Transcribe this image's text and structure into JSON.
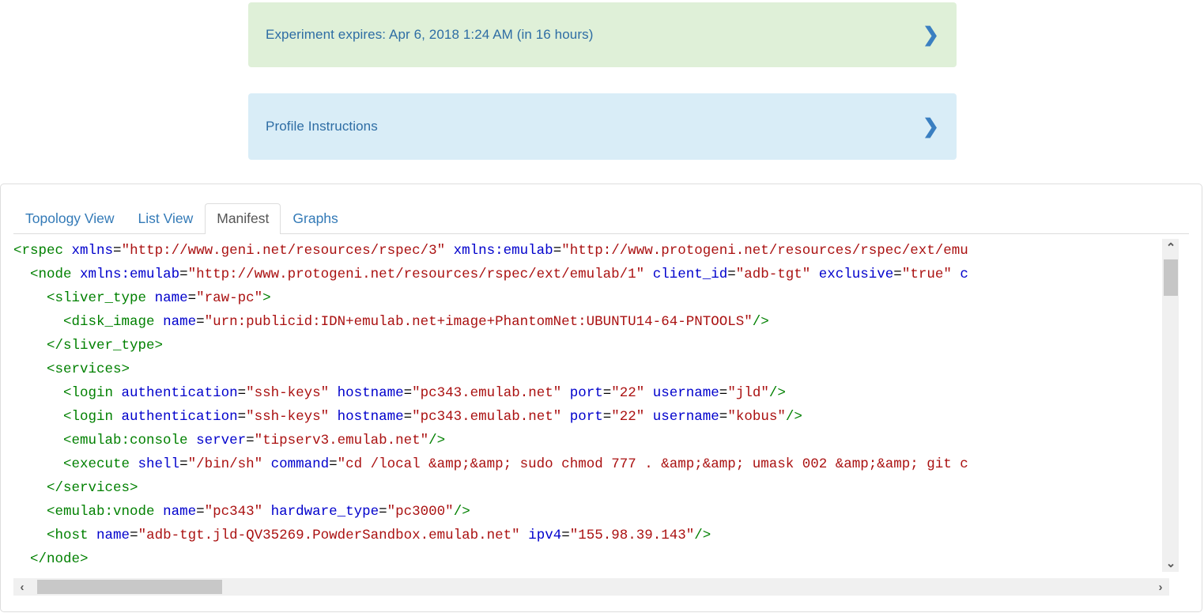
{
  "banners": [
    {
      "id": "expires",
      "label": "Experiment expires: Apr 6, 2018 1:24 AM (in 16 hours)",
      "chevron": "chevron-right-icon",
      "chevron_glyph": "❯",
      "background": "#dff0d8",
      "text_color": "#2e6da4"
    },
    {
      "id": "instructions",
      "label": "Profile Instructions",
      "chevron": "chevron-right-icon",
      "chevron_glyph": "❯",
      "background": "#d9edf7",
      "text_color": "#2e6da4"
    }
  ],
  "tabs": [
    {
      "label": "Topology View",
      "active": false
    },
    {
      "label": "List View",
      "active": false
    },
    {
      "label": "Manifest",
      "active": true
    },
    {
      "label": "Graphs",
      "active": false
    }
  ],
  "manifest": {
    "language": "xml",
    "colors": {
      "tag": "#008000",
      "attribute": "#0000cc",
      "value": "#aa1111",
      "plain": "#000000"
    },
    "lines": [
      {
        "indent": 0,
        "tokens": [
          {
            "t": "tag",
            "s": "<rspec"
          },
          {
            "t": "plain",
            "s": " "
          },
          {
            "t": "attr",
            "s": "xmlns"
          },
          {
            "t": "plain",
            "s": "="
          },
          {
            "t": "val",
            "s": "\"http://www.geni.net/resources/rspec/3\""
          },
          {
            "t": "plain",
            "s": " "
          },
          {
            "t": "attr",
            "s": "xmlns:emulab"
          },
          {
            "t": "plain",
            "s": "="
          },
          {
            "t": "val",
            "s": "\"http://www.protogeni.net/resources/rspec/ext/emu"
          }
        ]
      },
      {
        "indent": 1,
        "tokens": [
          {
            "t": "tag",
            "s": "<node"
          },
          {
            "t": "plain",
            "s": " "
          },
          {
            "t": "attr",
            "s": "xmlns:emulab"
          },
          {
            "t": "plain",
            "s": "="
          },
          {
            "t": "val",
            "s": "\"http://www.protogeni.net/resources/rspec/ext/emulab/1\""
          },
          {
            "t": "plain",
            "s": " "
          },
          {
            "t": "attr",
            "s": "client_id"
          },
          {
            "t": "plain",
            "s": "="
          },
          {
            "t": "val",
            "s": "\"adb-tgt\""
          },
          {
            "t": "plain",
            "s": " "
          },
          {
            "t": "attr",
            "s": "exclusive"
          },
          {
            "t": "plain",
            "s": "="
          },
          {
            "t": "val",
            "s": "\"true\""
          },
          {
            "t": "plain",
            "s": " "
          },
          {
            "t": "attr",
            "s": "c"
          }
        ]
      },
      {
        "indent": 2,
        "tokens": [
          {
            "t": "tag",
            "s": "<sliver_type"
          },
          {
            "t": "plain",
            "s": " "
          },
          {
            "t": "attr",
            "s": "name"
          },
          {
            "t": "plain",
            "s": "="
          },
          {
            "t": "val",
            "s": "\"raw-pc\""
          },
          {
            "t": "tag",
            "s": ">"
          }
        ]
      },
      {
        "indent": 3,
        "tokens": [
          {
            "t": "tag",
            "s": "<disk_image"
          },
          {
            "t": "plain",
            "s": " "
          },
          {
            "t": "attr",
            "s": "name"
          },
          {
            "t": "plain",
            "s": "="
          },
          {
            "t": "val",
            "s": "\"urn:publicid:IDN+emulab.net+image+PhantomNet:UBUNTU14-64-PNTOOLS\""
          },
          {
            "t": "tag",
            "s": "/>"
          }
        ]
      },
      {
        "indent": 2,
        "tokens": [
          {
            "t": "tag",
            "s": "</sliver_type>"
          }
        ]
      },
      {
        "indent": 2,
        "tokens": [
          {
            "t": "tag",
            "s": "<services>"
          }
        ]
      },
      {
        "indent": 3,
        "tokens": [
          {
            "t": "tag",
            "s": "<login"
          },
          {
            "t": "plain",
            "s": " "
          },
          {
            "t": "attr",
            "s": "authentication"
          },
          {
            "t": "plain",
            "s": "="
          },
          {
            "t": "val",
            "s": "\"ssh-keys\""
          },
          {
            "t": "plain",
            "s": " "
          },
          {
            "t": "attr",
            "s": "hostname"
          },
          {
            "t": "plain",
            "s": "="
          },
          {
            "t": "val",
            "s": "\"pc343.emulab.net\""
          },
          {
            "t": "plain",
            "s": " "
          },
          {
            "t": "attr",
            "s": "port"
          },
          {
            "t": "plain",
            "s": "="
          },
          {
            "t": "val",
            "s": "\"22\""
          },
          {
            "t": "plain",
            "s": " "
          },
          {
            "t": "attr",
            "s": "username"
          },
          {
            "t": "plain",
            "s": "="
          },
          {
            "t": "val",
            "s": "\"jld\""
          },
          {
            "t": "tag",
            "s": "/>"
          }
        ]
      },
      {
        "indent": 3,
        "tokens": [
          {
            "t": "tag",
            "s": "<login"
          },
          {
            "t": "plain",
            "s": " "
          },
          {
            "t": "attr",
            "s": "authentication"
          },
          {
            "t": "plain",
            "s": "="
          },
          {
            "t": "val",
            "s": "\"ssh-keys\""
          },
          {
            "t": "plain",
            "s": " "
          },
          {
            "t": "attr",
            "s": "hostname"
          },
          {
            "t": "plain",
            "s": "="
          },
          {
            "t": "val",
            "s": "\"pc343.emulab.net\""
          },
          {
            "t": "plain",
            "s": " "
          },
          {
            "t": "attr",
            "s": "port"
          },
          {
            "t": "plain",
            "s": "="
          },
          {
            "t": "val",
            "s": "\"22\""
          },
          {
            "t": "plain",
            "s": " "
          },
          {
            "t": "attr",
            "s": "username"
          },
          {
            "t": "plain",
            "s": "="
          },
          {
            "t": "val",
            "s": "\"kobus\""
          },
          {
            "t": "tag",
            "s": "/>"
          }
        ]
      },
      {
        "indent": 3,
        "tokens": [
          {
            "t": "tag",
            "s": "<emulab:console"
          },
          {
            "t": "plain",
            "s": " "
          },
          {
            "t": "attr",
            "s": "server"
          },
          {
            "t": "plain",
            "s": "="
          },
          {
            "t": "val",
            "s": "\"tipserv3.emulab.net\""
          },
          {
            "t": "tag",
            "s": "/>"
          }
        ]
      },
      {
        "indent": 3,
        "tokens": [
          {
            "t": "tag",
            "s": "<execute"
          },
          {
            "t": "plain",
            "s": " "
          },
          {
            "t": "attr",
            "s": "shell"
          },
          {
            "t": "plain",
            "s": "="
          },
          {
            "t": "val",
            "s": "\"/bin/sh\""
          },
          {
            "t": "plain",
            "s": " "
          },
          {
            "t": "attr",
            "s": "command"
          },
          {
            "t": "plain",
            "s": "="
          },
          {
            "t": "val",
            "s": "\"cd /local &amp;&amp; sudo chmod 777 . &amp;&amp; umask 002 &amp;&amp; git c"
          }
        ]
      },
      {
        "indent": 2,
        "tokens": [
          {
            "t": "tag",
            "s": "</services>"
          }
        ]
      },
      {
        "indent": 2,
        "tokens": [
          {
            "t": "tag",
            "s": "<emulab:vnode"
          },
          {
            "t": "plain",
            "s": " "
          },
          {
            "t": "attr",
            "s": "name"
          },
          {
            "t": "plain",
            "s": "="
          },
          {
            "t": "val",
            "s": "\"pc343\""
          },
          {
            "t": "plain",
            "s": " "
          },
          {
            "t": "attr",
            "s": "hardware_type"
          },
          {
            "t": "plain",
            "s": "="
          },
          {
            "t": "val",
            "s": "\"pc3000\""
          },
          {
            "t": "tag",
            "s": "/>"
          }
        ]
      },
      {
        "indent": 2,
        "tokens": [
          {
            "t": "tag",
            "s": "<host"
          },
          {
            "t": "plain",
            "s": " "
          },
          {
            "t": "attr",
            "s": "name"
          },
          {
            "t": "plain",
            "s": "="
          },
          {
            "t": "val",
            "s": "\"adb-tgt.jld-QV35269.PowderSandbox.emulab.net\""
          },
          {
            "t": "plain",
            "s": " "
          },
          {
            "t": "attr",
            "s": "ipv4"
          },
          {
            "t": "plain",
            "s": "="
          },
          {
            "t": "val",
            "s": "\"155.98.39.143\""
          },
          {
            "t": "tag",
            "s": "/>"
          }
        ]
      },
      {
        "indent": 1,
        "tokens": [
          {
            "t": "tag",
            "s": "</node>"
          }
        ]
      }
    ]
  },
  "scrollbars": {
    "vertical": {
      "up_glyph": "⌃",
      "down_glyph": "⌄",
      "up_icon": "scroll-up-icon",
      "down_icon": "scroll-down-icon"
    },
    "horizontal": {
      "left_glyph": "‹",
      "right_glyph": "›",
      "left_icon": "scroll-left-icon",
      "right_icon": "scroll-right-icon"
    }
  }
}
